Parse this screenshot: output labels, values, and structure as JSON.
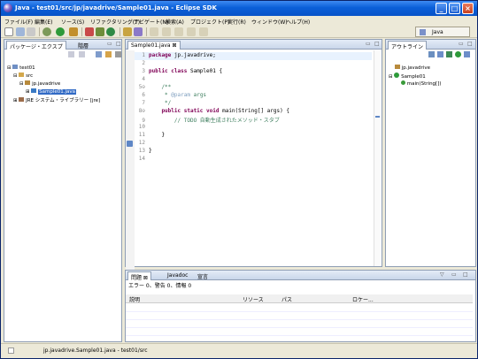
{
  "window": {
    "title": "Java - test01/src/jp/javadrive/Sample01.java - Eclipse SDK",
    "buttons": [
      "_",
      "□",
      "×"
    ]
  },
  "menu": [
    "ファイル(F)",
    "編集(E)",
    "ソース(S)",
    "リファクタリング(T)",
    "ナビゲート(N)",
    "検索(A)",
    "プロジェクト(P)",
    "実行(R)",
    "ウィンドウ(W)",
    "ヘルプ(H)"
  ],
  "perspective": {
    "label": "Java"
  },
  "package_explorer": {
    "tabs": [
      "パッケージ・エクスプ",
      "階層"
    ],
    "tree": [
      "test01",
      "src",
      "jp.javadrive",
      "Sample01.java",
      "JRE システム・ライブラリー [jre]"
    ]
  },
  "editor": {
    "tab": "Sample01.java",
    "lines": [
      {
        "n": "1"
      },
      {
        "n": "2"
      },
      {
        "n": "3"
      },
      {
        "n": "4"
      },
      {
        "n": "5⊖"
      },
      {
        "n": "6"
      },
      {
        "n": "7"
      },
      {
        "n": "8⊖"
      },
      {
        "n": "9"
      },
      {
        "n": "10"
      },
      {
        "n": "11"
      },
      {
        "n": "12"
      },
      {
        "n": "13"
      },
      {
        "n": "14"
      }
    ],
    "code": {
      "l1_kw": "package",
      "l1_rest": " jp.javadrive;",
      "l3_kw": "public class",
      "l3_rest": " Sample01 {",
      "l5": "    /**",
      "l6_a": "     * ",
      "l6_tag": "@param",
      "l6_b": " args",
      "l7": "     */",
      "l8_kw": "    public static void",
      "l8_rest": " main(String[] args) {",
      "l9": "        // TODO 自動生成されたメソッド・スタブ",
      "l11": "    }",
      "l13": "}"
    }
  },
  "outline": {
    "tab": "アウトライン",
    "items": [
      "jp.javadrive",
      "Sample01",
      "main(String[])"
    ]
  },
  "problems": {
    "tabs": [
      "問題",
      "Javadoc",
      "宣言"
    ],
    "summary": "エラー 0、警告 0、情報 0",
    "columns": [
      "説明",
      "リソース",
      "パス",
      "ロケー..."
    ]
  },
  "statusbar": {
    "text": "jp.javadrive.Sample01.java - test01/src"
  }
}
